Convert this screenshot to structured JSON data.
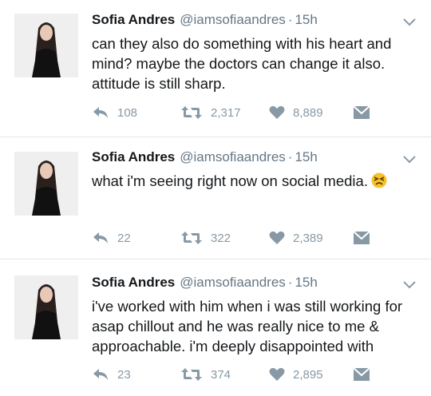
{
  "tweets": [
    {
      "name": "Sofia Andres",
      "handle": "@iamsofiaandres",
      "separator": "·",
      "time": "15h",
      "text": "can they also do something with his heart and mind? maybe the doctors can change it also. attitude is still sharp.",
      "replies": "108",
      "retweets": "2,317",
      "likes": "8,889",
      "emoji": null
    },
    {
      "name": "Sofia Andres",
      "handle": "@iamsofiaandres",
      "separator": "·",
      "time": "15h",
      "text": "what i'm seeing right now on social media.",
      "replies": "22",
      "retweets": "322",
      "likes": "2,389",
      "emoji": "persevering-face-emoji"
    },
    {
      "name": "Sofia Andres",
      "handle": "@iamsofiaandres",
      "separator": "·",
      "time": "15h",
      "text": "i've worked with him when i was still working for asap chillout and he was really nice to me & approachable. i'm deeply disappointed with",
      "replies": "23",
      "retweets": "374",
      "likes": "2,895",
      "emoji": null
    }
  ],
  "icons": {
    "reply": "reply-arrow-icon",
    "retweet": "retweet-icon",
    "like": "heart-icon",
    "dm": "envelope-icon",
    "menu": "chevron-down-icon"
  },
  "colors": {
    "text": "#14171a",
    "muted": "#657786",
    "action": "#8899a6",
    "divider": "#e1e8ed"
  }
}
